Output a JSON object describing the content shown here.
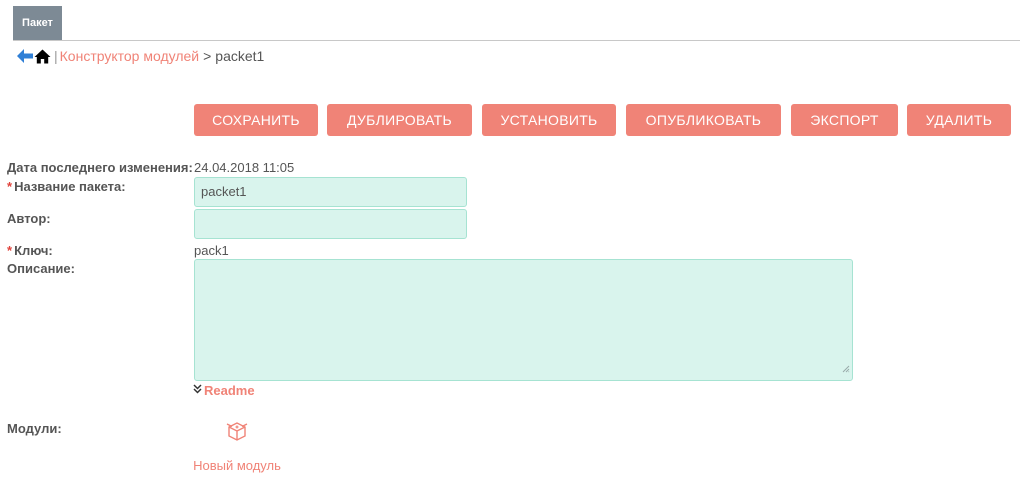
{
  "tab": {
    "label": "Пакет"
  },
  "breadcrumb": {
    "separator": "|",
    "link": "Конструктор модулей",
    "gt": ">",
    "current": "packet1"
  },
  "toolbar": {
    "save": "СОХРАНИТЬ",
    "duplicate": "ДУБЛИРОВАТЬ",
    "install": "УСТАНОВИТЬ",
    "publish": "ОПУБЛИКОВАТЬ",
    "export": "ЭКСПОРТ",
    "delete": "УДАЛИТЬ"
  },
  "form": {
    "last_modified_label": "Дата последнего изменения:",
    "last_modified_value": "24.04.2018 11:05",
    "required_mark": "*",
    "package_name_label": "Название пакета:",
    "package_name_value": "packet1",
    "author_label": "Автор:",
    "author_value": "",
    "key_label": "Ключ:",
    "key_value": "pack1",
    "description_label": "Описание:",
    "description_value": "",
    "readme_link": "Readme",
    "modules_label": "Модули:",
    "new_module_label": "Новый модуль"
  },
  "colors": {
    "accent": "#f08377",
    "tab_bg": "#7d8a95",
    "input_bg": "#d9f4ed",
    "input_border": "#a6e3d2",
    "required": "#e0413a"
  }
}
